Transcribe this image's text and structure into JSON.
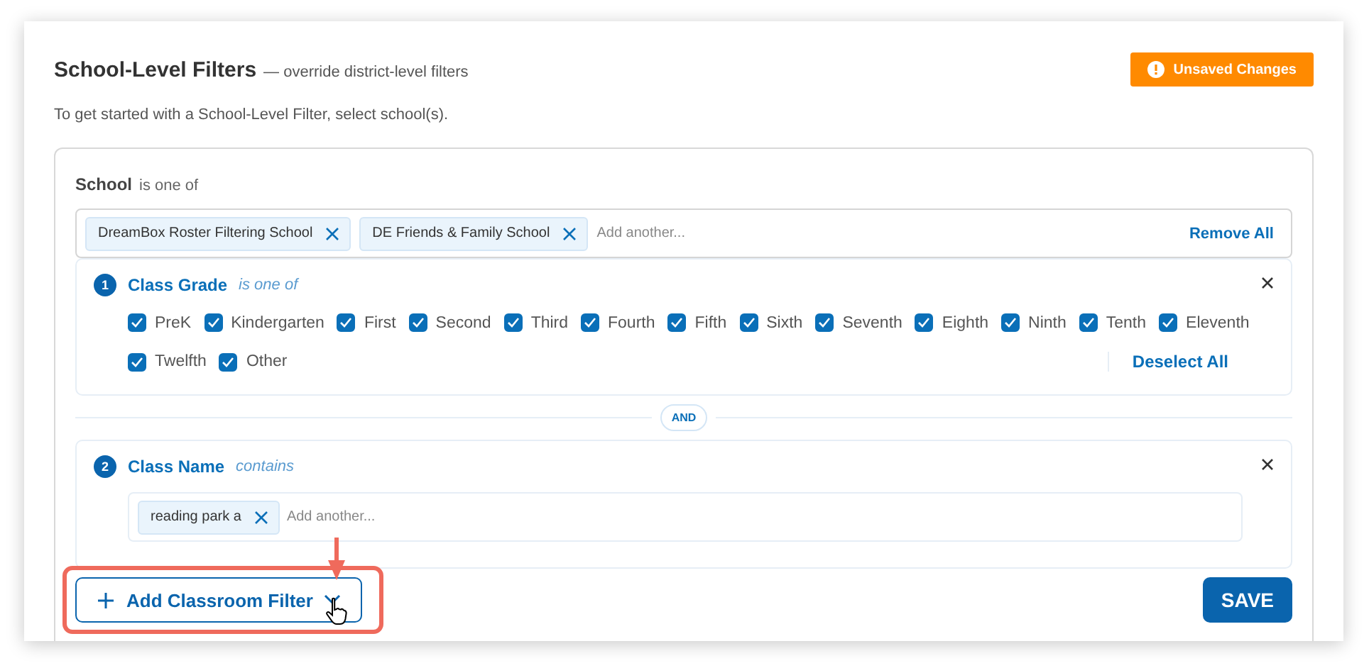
{
  "header": {
    "title": "School-Level Filters",
    "subtitle": "— override district-level filters",
    "badge": "Unsaved Changes"
  },
  "intro": "To get started with a School-Level Filter, select school(s).",
  "school": {
    "label": "School",
    "operator": "is one of",
    "tags": [
      "DreamBox Roster Filtering School",
      "DE Friends & Family School"
    ],
    "placeholder": "Add another...",
    "remove_all": "Remove All"
  },
  "filters": [
    {
      "kind": "checkboxes",
      "number": "1",
      "name": "Class Grade",
      "operator": "is one of",
      "options": [
        {
          "label": "PreK",
          "checked": true
        },
        {
          "label": "Kindergarten",
          "checked": true
        },
        {
          "label": "First",
          "checked": true
        },
        {
          "label": "Second",
          "checked": true
        },
        {
          "label": "Third",
          "checked": true
        },
        {
          "label": "Fourth",
          "checked": true
        },
        {
          "label": "Fifth",
          "checked": true
        },
        {
          "label": "Sixth",
          "checked": true
        },
        {
          "label": "Seventh",
          "checked": true
        },
        {
          "label": "Eighth",
          "checked": true
        },
        {
          "label": "Ninth",
          "checked": true
        },
        {
          "label": "Tenth",
          "checked": true
        },
        {
          "label": "Eleventh",
          "checked": true
        },
        {
          "label": "Twelfth",
          "checked": true
        },
        {
          "label": "Other",
          "checked": true
        }
      ],
      "action": "Deselect All"
    },
    {
      "kind": "tags",
      "number": "2",
      "name": "Class Name",
      "operator": "contains",
      "tags": [
        "reading park a"
      ],
      "placeholder": "Add another..."
    }
  ],
  "joiner": "AND",
  "add_button": "Add Classroom Filter",
  "save_button": "SAVE"
}
